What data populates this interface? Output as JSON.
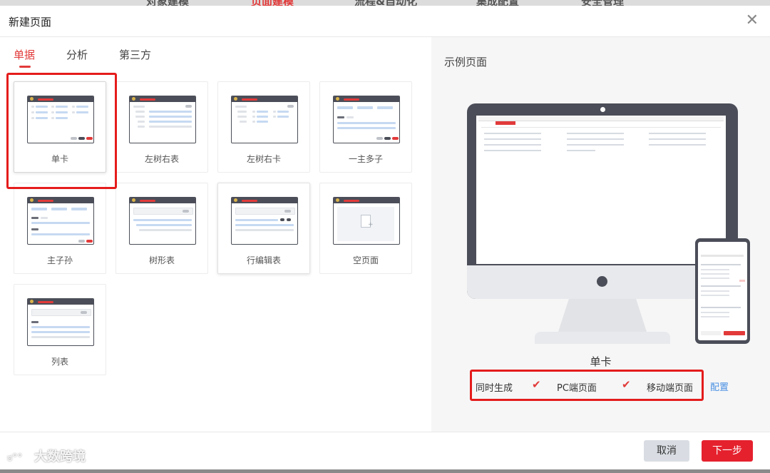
{
  "top_nav": [
    "对象建模",
    "页面建模",
    "流程&自动化",
    "集成配置",
    "安全管理"
  ],
  "dialog": {
    "title": "新建页面"
  },
  "tabs": [
    {
      "label": "单据"
    },
    {
      "label": "分析"
    },
    {
      "label": "第三方"
    }
  ],
  "templates": [
    {
      "label": "单卡"
    },
    {
      "label": "左树右表"
    },
    {
      "label": "左树右卡"
    },
    {
      "label": "一主多子"
    },
    {
      "label": "主子孙"
    },
    {
      "label": "树形表"
    },
    {
      "label": "行编辑表"
    },
    {
      "label": "空页面"
    },
    {
      "label": "列表"
    }
  ],
  "selected_template": "单卡",
  "preview": {
    "title": "示例页面",
    "caption": "单卡",
    "options": {
      "sync_label": "同时生成",
      "pc_label": "PC端页面",
      "pc_checked": true,
      "mobile_label": "移动端页面",
      "mobile_checked": true
    },
    "config_link": "配置"
  },
  "footer": {
    "cancel_label": "取消",
    "next_label": "下一步"
  },
  "watermark": "大数跨境",
  "colors": {
    "accent": "#e23a3a",
    "link": "#4a90e2",
    "highlight": "#e51c1c"
  }
}
